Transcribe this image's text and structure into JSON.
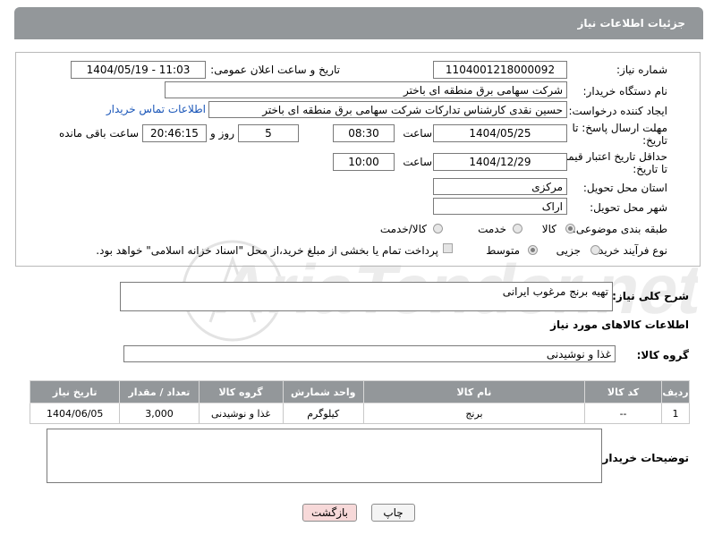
{
  "header": {
    "title": "جزئیات اطلاعات نیاز"
  },
  "form": {
    "need_number_label": "شماره نیاز:",
    "need_number": "1104001218000092",
    "announce_label": "تاریخ و ساعت اعلان عمومی:",
    "announce_value": "1404/05/19 - 11:03",
    "buyer_org_label": "نام دستگاه خریدار:",
    "buyer_org": "شرکت سهامی برق منطقه ای باختر",
    "creator_label": "ایجاد کننده درخواست:",
    "creator": "حسین نقدی کارشناس تدارکات شرکت سهامی برق منطقه ای باختر",
    "contact_link": "اطلاعات تماس خریدار",
    "deadline_label_1": "مهلت ارسال پاسخ: تا",
    "deadline_label_2": "تاریخ:",
    "deadline_date": "1404/05/25",
    "time_label": "ساعت",
    "deadline_time": "08:30",
    "days_value": "5",
    "days_label": "روز و",
    "remaining_time": "20:46:15",
    "remaining_label": "ساعت باقی مانده",
    "validity_label_1": "حداقل تاریخ اعتبار قیمت:",
    "validity_label_2": "تا تاریخ:",
    "validity_date": "1404/12/29",
    "validity_time": "10:00",
    "province_label": "استان محل تحویل:",
    "province": "مرکزی",
    "city_label": "شهر محل تحویل:",
    "city": "اراک",
    "category_label": "طبقه بندی موضوعی:",
    "category_options": [
      "کالا",
      "خدمت",
      "کالا/خدمت"
    ],
    "category_selected": "کالا",
    "process_label": "نوع فرآیند خرید :",
    "process_options": [
      "جزیی",
      "متوسط"
    ],
    "process_selected": "متوسط",
    "payment_note": "پرداخت تمام یا بخشی از مبلغ خرید،از محل \"اسناد خزانه اسلامی\" خواهد بود."
  },
  "description": {
    "label": "شرح کلی نیاز:",
    "value": "تهیه برنج مرغوب ایرانی"
  },
  "goods": {
    "section_title": "اطلاعات کالاهای مورد نیاز",
    "group_label": "گروه کالا:",
    "group_value": "غذا و نوشیدنی",
    "columns": [
      "ردیف",
      "کد کالا",
      "نام کالا",
      "واحد شمارش",
      "گروه کالا",
      "تعداد / مقدار",
      "تاریخ نیاز"
    ],
    "rows": [
      {
        "row": "1",
        "code": "--",
        "name": "برنج",
        "unit": "کیلوگرم",
        "group": "غذا و نوشیدنی",
        "qty": "3,000",
        "date": "1404/06/05"
      }
    ]
  },
  "buyer_notes": {
    "label": "توضیحات خریدار:",
    "value": ""
  },
  "buttons": {
    "print": "چاپ",
    "back": "بازگشت"
  },
  "colors": {
    "header_bg": "#93979a",
    "link": "#1a56b8",
    "back_button_bg": "#f7d9d9"
  }
}
